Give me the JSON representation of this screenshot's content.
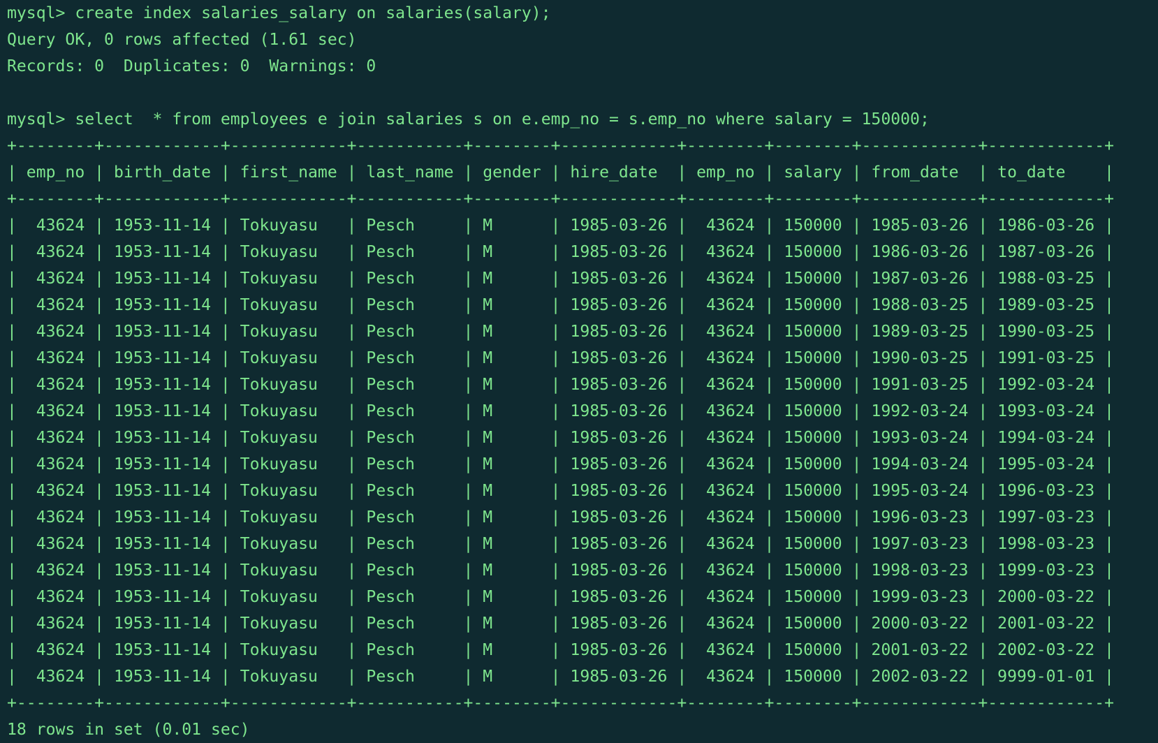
{
  "terminal": {
    "lines": [
      "mysql> create index salaries_salary on salaries(salary);",
      "Query OK, 0 rows affected (1.61 sec)",
      "Records: 0  Duplicates: 0  Warnings: 0",
      "",
      "mysql> select  * from employees e join salaries s on e.emp_no = s.emp_no where salary = 150000;"
    ],
    "table": {
      "border": "+--------+------------+------------+-----------+--------+------------+--------+--------+------------+------------+",
      "header": "| emp_no | birth_date | first_name | last_name | gender | hire_date  | emp_no | salary | from_date  | to_date    |",
      "rows": [
        "|  43624 | 1953-11-14 | Tokuyasu   | Pesch     | M      | 1985-03-26 |  43624 | 150000 | 1985-03-26 | 1986-03-26 |",
        "|  43624 | 1953-11-14 | Tokuyasu   | Pesch     | M      | 1985-03-26 |  43624 | 150000 | 1986-03-26 | 1987-03-26 |",
        "|  43624 | 1953-11-14 | Tokuyasu   | Pesch     | M      | 1985-03-26 |  43624 | 150000 | 1987-03-26 | 1988-03-25 |",
        "|  43624 | 1953-11-14 | Tokuyasu   | Pesch     | M      | 1985-03-26 |  43624 | 150000 | 1988-03-25 | 1989-03-25 |",
        "|  43624 | 1953-11-14 | Tokuyasu   | Pesch     | M      | 1985-03-26 |  43624 | 150000 | 1989-03-25 | 1990-03-25 |",
        "|  43624 | 1953-11-14 | Tokuyasu   | Pesch     | M      | 1985-03-26 |  43624 | 150000 | 1990-03-25 | 1991-03-25 |",
        "|  43624 | 1953-11-14 | Tokuyasu   | Pesch     | M      | 1985-03-26 |  43624 | 150000 | 1991-03-25 | 1992-03-24 |",
        "|  43624 | 1953-11-14 | Tokuyasu   | Pesch     | M      | 1985-03-26 |  43624 | 150000 | 1992-03-24 | 1993-03-24 |",
        "|  43624 | 1953-11-14 | Tokuyasu   | Pesch     | M      | 1985-03-26 |  43624 | 150000 | 1993-03-24 | 1994-03-24 |",
        "|  43624 | 1953-11-14 | Tokuyasu   | Pesch     | M      | 1985-03-26 |  43624 | 150000 | 1994-03-24 | 1995-03-24 |",
        "|  43624 | 1953-11-14 | Tokuyasu   | Pesch     | M      | 1985-03-26 |  43624 | 150000 | 1995-03-24 | 1996-03-23 |",
        "|  43624 | 1953-11-14 | Tokuyasu   | Pesch     | M      | 1985-03-26 |  43624 | 150000 | 1996-03-23 | 1997-03-23 |",
        "|  43624 | 1953-11-14 | Tokuyasu   | Pesch     | M      | 1985-03-26 |  43624 | 150000 | 1997-03-23 | 1998-03-23 |",
        "|  43624 | 1953-11-14 | Tokuyasu   | Pesch     | M      | 1985-03-26 |  43624 | 150000 | 1998-03-23 | 1999-03-23 |",
        "|  43624 | 1953-11-14 | Tokuyasu   | Pesch     | M      | 1985-03-26 |  43624 | 150000 | 1999-03-23 | 2000-03-22 |",
        "|  43624 | 1953-11-14 | Tokuyasu   | Pesch     | M      | 1985-03-26 |  43624 | 150000 | 2000-03-22 | 2001-03-22 |",
        "|  43624 | 1953-11-14 | Tokuyasu   | Pesch     | M      | 1985-03-26 |  43624 | 150000 | 2001-03-22 | 2002-03-22 |",
        "|  43624 | 1953-11-14 | Tokuyasu   | Pesch     | M      | 1985-03-26 |  43624 | 150000 | 2002-03-22 | 9999-01-01 |"
      ]
    },
    "footer": "18 rows in set (0.01 sec)"
  },
  "colors": {
    "background": "#0f2a30",
    "text": "#7ee58d"
  }
}
